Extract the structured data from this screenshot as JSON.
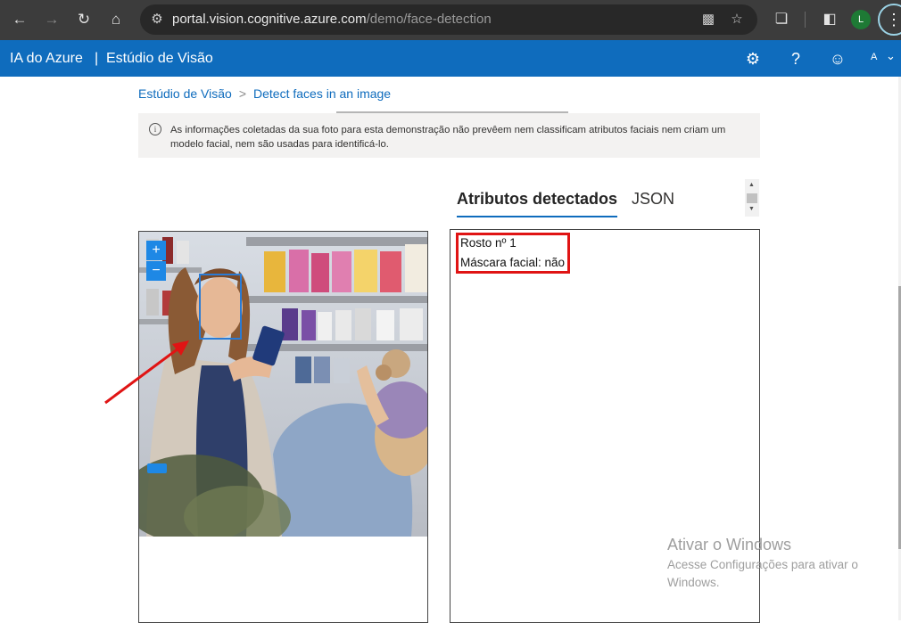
{
  "browser": {
    "url_host": "portal.vision.cognitive.azure.com",
    "url_path": "/demo/face-detection",
    "profile_initial": "L"
  },
  "header": {
    "brand": "IA do Azure",
    "divider": "|",
    "studio": "Estúdio de Visão",
    "user_initial": "A"
  },
  "breadcrumb": {
    "home": "Estúdio de Visão",
    "separator": ">",
    "current": "Detect faces in an image"
  },
  "notice": {
    "icon": "i",
    "text": "As informações coletadas da sua foto para esta demonstração não prevêem nem classificam atributos faciais nem criam um modelo facial, nem são usadas para identificá-lo."
  },
  "tabs": {
    "attributes": "Atributos detectados",
    "json": "JSON"
  },
  "image_controls": {
    "zoom_in": "+",
    "zoom_out": "−"
  },
  "results": {
    "face_label": "Rosto nº 1",
    "mask_label": "Máscara facial: não"
  },
  "watermark": {
    "title": "Ativar o Windows",
    "line1": "Acesse Configurações para ativar o",
    "line2": "Windows."
  },
  "colors": {
    "azure_blue": "#0f6cbd",
    "highlight_red": "#e01414",
    "face_box": "#2a7bd4"
  }
}
